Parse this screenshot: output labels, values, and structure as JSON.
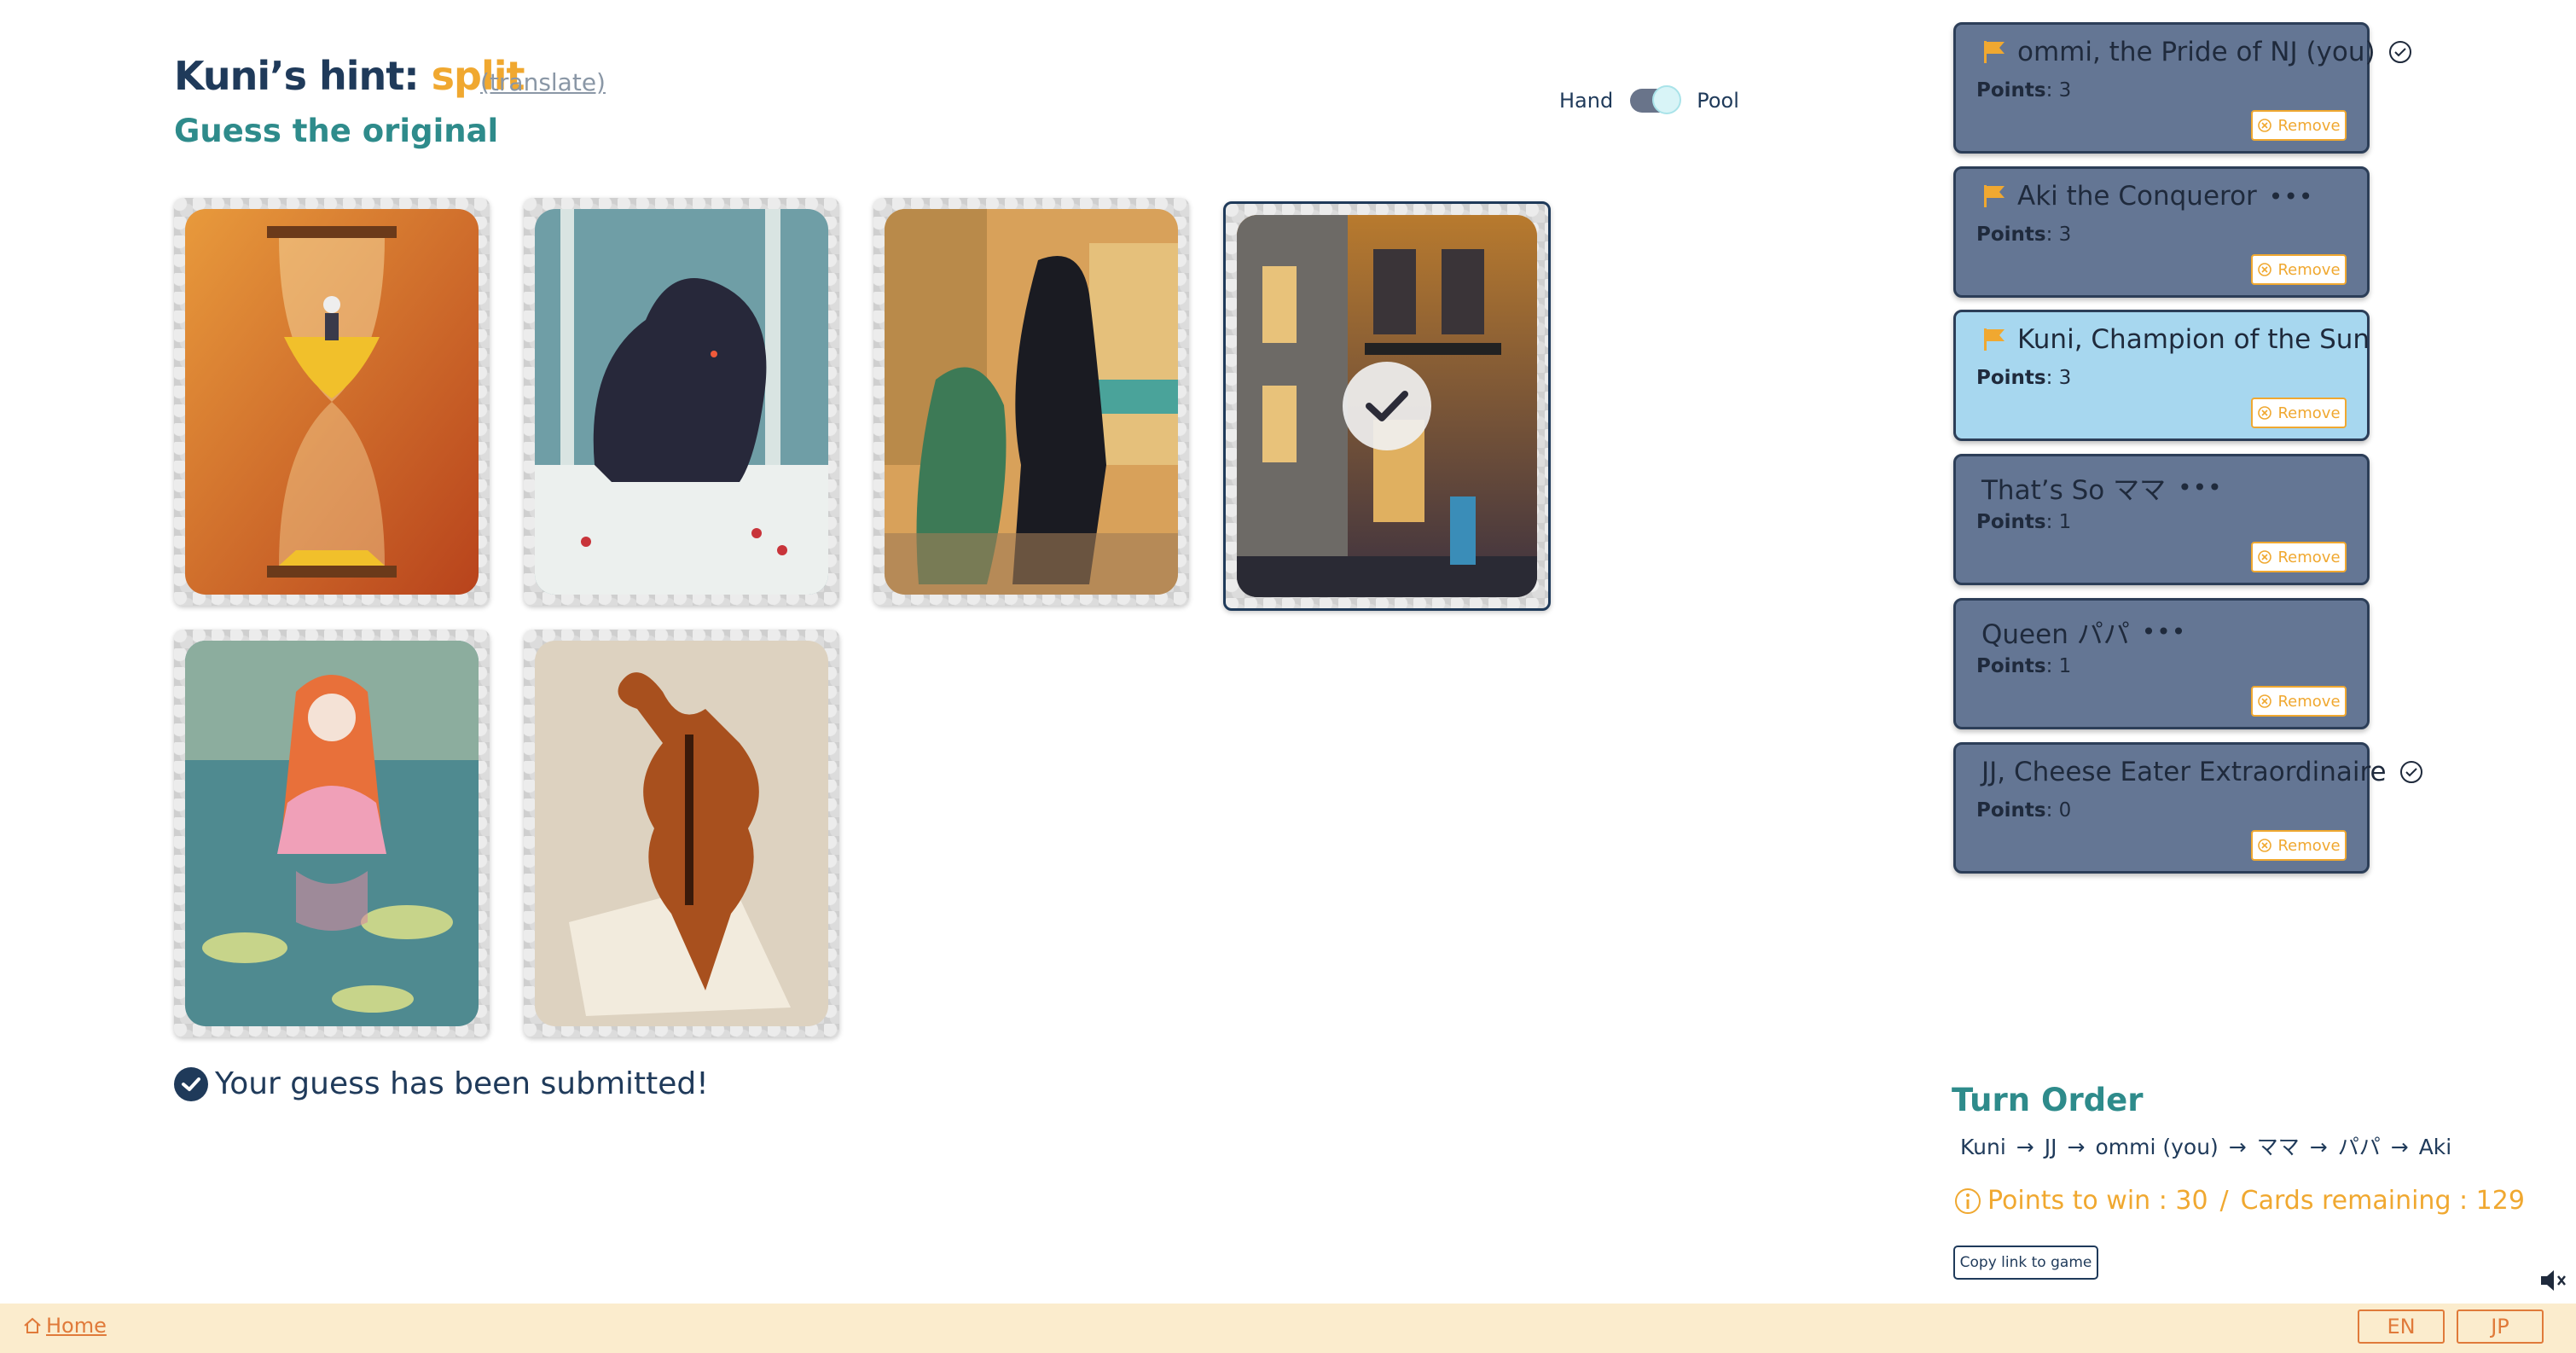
{
  "hint": {
    "prefix": "Kuni’s hint: ",
    "word": "split",
    "translate_label": "(translate)",
    "subtitle": "Guess the original"
  },
  "toggle": {
    "left_label": "Hand",
    "right_label": "Pool",
    "state": "Pool"
  },
  "cards": [
    {
      "name": "hourglass-card",
      "selected": false
    },
    {
      "name": "black-wolf-card",
      "selected": false
    },
    {
      "name": "silhouette-street-card",
      "selected": false
    },
    {
      "name": "night-building-card",
      "selected": true
    },
    {
      "name": "girl-in-pond-card",
      "selected": false
    },
    {
      "name": "violin-card",
      "selected": false
    }
  ],
  "status": {
    "submitted_text": "Your guess has been submitted!"
  },
  "players": [
    {
      "name": "ommi, the Pride of NJ (you)",
      "points_label": "Points",
      "points": ": 3",
      "flag": true,
      "marker": "check",
      "active": false,
      "remove_label": "Remove"
    },
    {
      "name": "Aki the Conqueror",
      "points_label": "Points",
      "points": ": 3",
      "flag": true,
      "marker": "dots",
      "active": false,
      "remove_label": "Remove"
    },
    {
      "name": "Kuni, Champion of the Sun",
      "points_label": "Points",
      "points": ": 3",
      "flag": true,
      "marker": "none",
      "active": true,
      "remove_label": "Remove"
    },
    {
      "name": "That’s So ママ",
      "points_label": "Points",
      "points": ": 1",
      "flag": false,
      "marker": "dots",
      "active": false,
      "remove_label": "Remove"
    },
    {
      "name": "Queen パパ",
      "points_label": "Points",
      "points": ": 1",
      "flag": false,
      "marker": "dots",
      "active": false,
      "remove_label": "Remove"
    },
    {
      "name": "JJ, Cheese Eater Extraordinaire",
      "points_label": "Points",
      "points": ": 0",
      "flag": false,
      "marker": "check",
      "active": false,
      "remove_label": "Remove"
    }
  ],
  "turn_order": {
    "title": "Turn Order",
    "names": [
      "Kuni",
      "JJ",
      "ommi (you)",
      "ママ",
      "パパ",
      "Aki"
    ]
  },
  "game_info": {
    "points_to_win": "Points to win : 30",
    "separator": "/",
    "cards_remaining": "Cards remaining : 129"
  },
  "copy_link_label": "Copy link to game",
  "footer": {
    "home_label": "Home",
    "lang_en": "EN",
    "lang_jp": "JP"
  },
  "colors": {
    "accent_orange": "#f0a830",
    "teal": "#2e8b8b",
    "navy": "#1f3a5a",
    "player_card": "#647694",
    "player_card_active": "#a7d7ef",
    "footer_bg": "#fbeccd"
  }
}
